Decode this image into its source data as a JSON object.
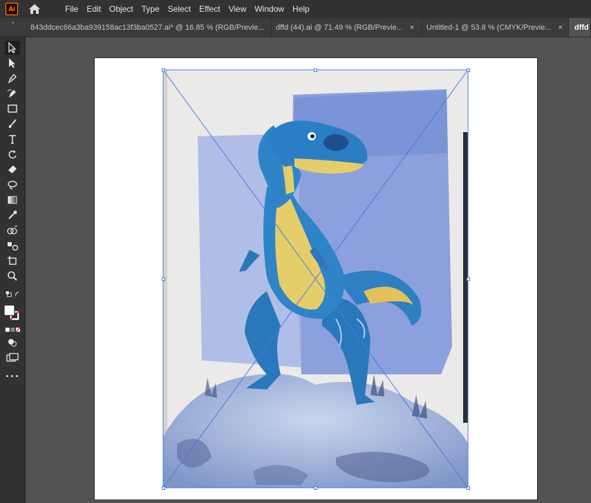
{
  "app": {
    "logo_text": "Ai",
    "logo_color": "#ff9a00"
  },
  "menubar": {
    "home_icon": "home-icon",
    "items": [
      "File",
      "Edit",
      "Object",
      "Type",
      "Select",
      "Effect",
      "View",
      "Window",
      "Help"
    ]
  },
  "tabs": [
    {
      "label": "843ddcec66a3ba939158ac13f3ba0527.ai* @ 16.85 % (RGB/Previe...",
      "close": "×",
      "active": false
    },
    {
      "label": "dffd (44).ai @ 71.49 % (RGB/Previe...",
      "close": "×",
      "active": false
    },
    {
      "label": "Untitled-1 @ 53.8 % (CMYK/Previe...",
      "close": "×",
      "active": false
    },
    {
      "label": "dffd",
      "close": "",
      "active": true
    }
  ],
  "tab_grip": "«",
  "tools": [
    "selection-tool-icon",
    "direct-selection-tool-icon",
    "pen-tool-icon",
    "curvature-tool-icon",
    "rectangle-tool-icon",
    "paintbrush-tool-icon",
    "type-tool-icon",
    "rotate-tool-icon",
    "eraser-tool-icon",
    "lasso-tool-icon",
    "gradient-tool-icon",
    "eyedropper-tool-icon",
    "shape-builder-tool-icon",
    "blend-tool-icon",
    "artboard-tool-icon",
    "zoom-tool-icon",
    "swap-colors-icon",
    "fill-stroke-swatch-icon",
    "color-mode-icon",
    "draw-mode-icon",
    "screen-mode-icon",
    "more-tools-icon"
  ],
  "more_tools": "•••",
  "colors": {
    "selection": "#4a78e0",
    "workspace": "#535353",
    "panel": "#323232"
  },
  "canvas": {
    "placed_image": "watercolor-dinosaur-illustration",
    "selection_box": "bounding-box-with-handles"
  }
}
